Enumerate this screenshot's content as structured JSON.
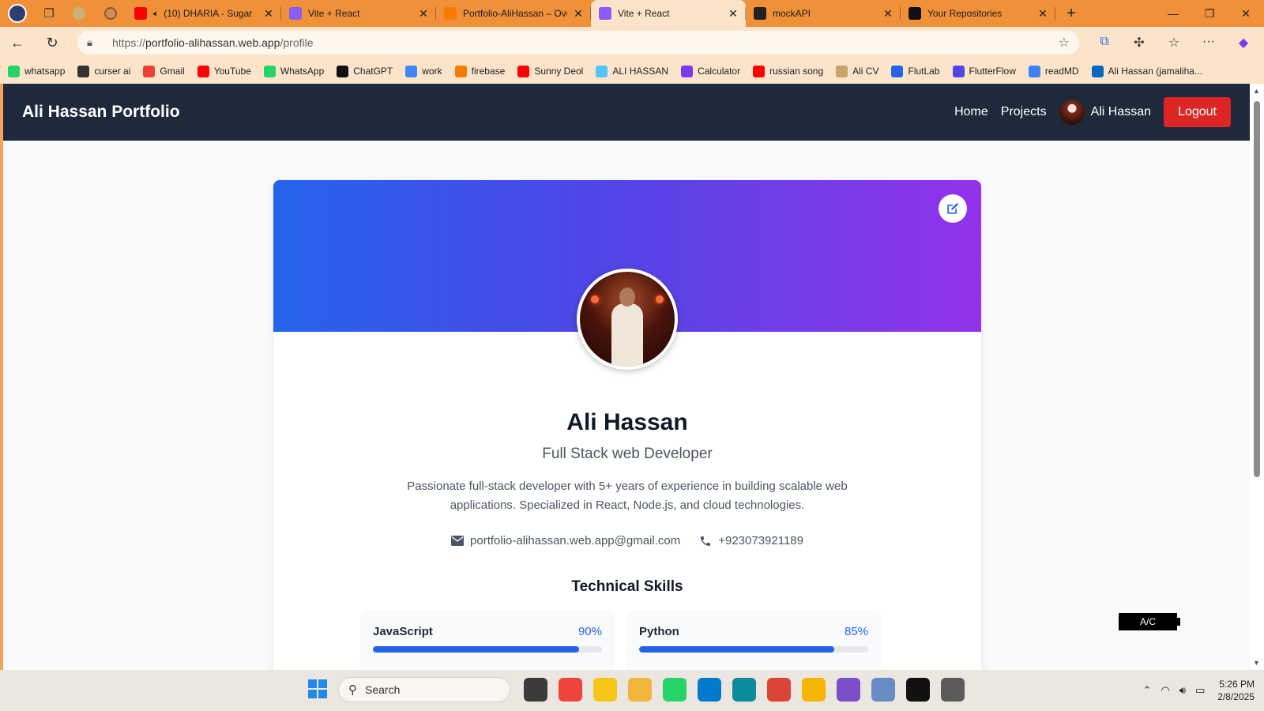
{
  "browser": {
    "tabs": [
      {
        "title": "(10) DHARIA - Sugar",
        "favicon": "youtube-icon",
        "color": "#ff0000",
        "active": false,
        "audio": true
      },
      {
        "title": "Vite + React",
        "favicon": "vite-icon",
        "color": "#8b5cf6",
        "active": false
      },
      {
        "title": "Portfolio-AliHassan – Over",
        "favicon": "firebase-icon",
        "color": "#f57c00",
        "active": false
      },
      {
        "title": "Vite + React",
        "favicon": "vite-icon",
        "color": "#8b5cf6",
        "active": true
      },
      {
        "title": "mockAPI",
        "favicon": "mockapi-icon",
        "color": "#222222",
        "active": false
      },
      {
        "title": "Your Repositories",
        "favicon": "github-icon",
        "color": "#111111",
        "active": false
      }
    ],
    "url_prefix": "https://",
    "url_host": "portfolio-alihassan.web.app",
    "url_path": "/profile",
    "bookmarks": [
      {
        "label": "whatsapp",
        "color": "#25d366"
      },
      {
        "label": "curser ai",
        "color": "#333333"
      },
      {
        "label": "Gmail",
        "color": "#ea4335"
      },
      {
        "label": "YouTube",
        "color": "#ff0000"
      },
      {
        "label": "WhatsApp",
        "color": "#25d366"
      },
      {
        "label": "ChatGPT",
        "color": "#111111"
      },
      {
        "label": "work",
        "color": "#4285f4"
      },
      {
        "label": "firebase",
        "color": "#f57c00"
      },
      {
        "label": "Sunny Deol",
        "color": "#ff0000"
      },
      {
        "label": "ALI HASSAN",
        "color": "#54c5f8"
      },
      {
        "label": "Calculator",
        "color": "#7c3aed"
      },
      {
        "label": "russian song",
        "color": "#ff0000"
      },
      {
        "label": "Ali CV",
        "color": "#caa36a"
      },
      {
        "label": "FlutLab",
        "color": "#2563eb"
      },
      {
        "label": "FlutterFlow",
        "color": "#4f46e5"
      },
      {
        "label": "readMD",
        "color": "#3b82f6"
      },
      {
        "label": "Ali Hassan (jamaliha...",
        "color": "#0a66c2"
      }
    ]
  },
  "site": {
    "brand": "Ali Hassan Portfolio",
    "nav": {
      "home": "Home",
      "projects": "Projects",
      "user": "Ali Hassan",
      "logout": "Logout"
    },
    "profile": {
      "name": "Ali Hassan",
      "role": "Full Stack web Developer",
      "bio": "Passionate full-stack developer with 5+ years of experience in building scalable web applications. Specialized in React, Node.js, and cloud technologies.",
      "email": "portfolio-alihassan.web.app@gmail.com",
      "phone": "+923073921189"
    },
    "skills_title": "Technical Skills",
    "skills": [
      {
        "name": "JavaScript",
        "percent_label": "90%",
        "level": 0.9
      },
      {
        "name": "Python",
        "percent_label": "85%",
        "level": 0.85
      }
    ],
    "overlay_label": "A/C"
  },
  "taskbar": {
    "search_placeholder": "Search",
    "time": "5:26 PM",
    "date": "2/8/2025",
    "apps": [
      {
        "name": "file-explorer-icon",
        "color": "#3b3b3b"
      },
      {
        "name": "anydesk-icon",
        "color": "#ef443b"
      },
      {
        "name": "app-icon",
        "color": "#f5c518"
      },
      {
        "name": "folder-icon",
        "color": "#f2b53b"
      },
      {
        "name": "whatsapp-icon",
        "color": "#25d366"
      },
      {
        "name": "vscode-icon",
        "color": "#007acc"
      },
      {
        "name": "edge-icon",
        "color": "#0c8c9a"
      },
      {
        "name": "chrome-icon",
        "color": "#db4437"
      },
      {
        "name": "chrome-canary-icon",
        "color": "#f4b400"
      },
      {
        "name": "visual-studio-icon",
        "color": "#7b4fc8"
      },
      {
        "name": "photos-icon",
        "color": "#6a8cc6"
      },
      {
        "name": "capcut-icon",
        "color": "#111111"
      },
      {
        "name": "clock-icon",
        "color": "#5a5a5a"
      }
    ]
  },
  "colors": {
    "accent": "#2563eb",
    "navbar": "#1e293b",
    "logout": "#dc2626"
  }
}
